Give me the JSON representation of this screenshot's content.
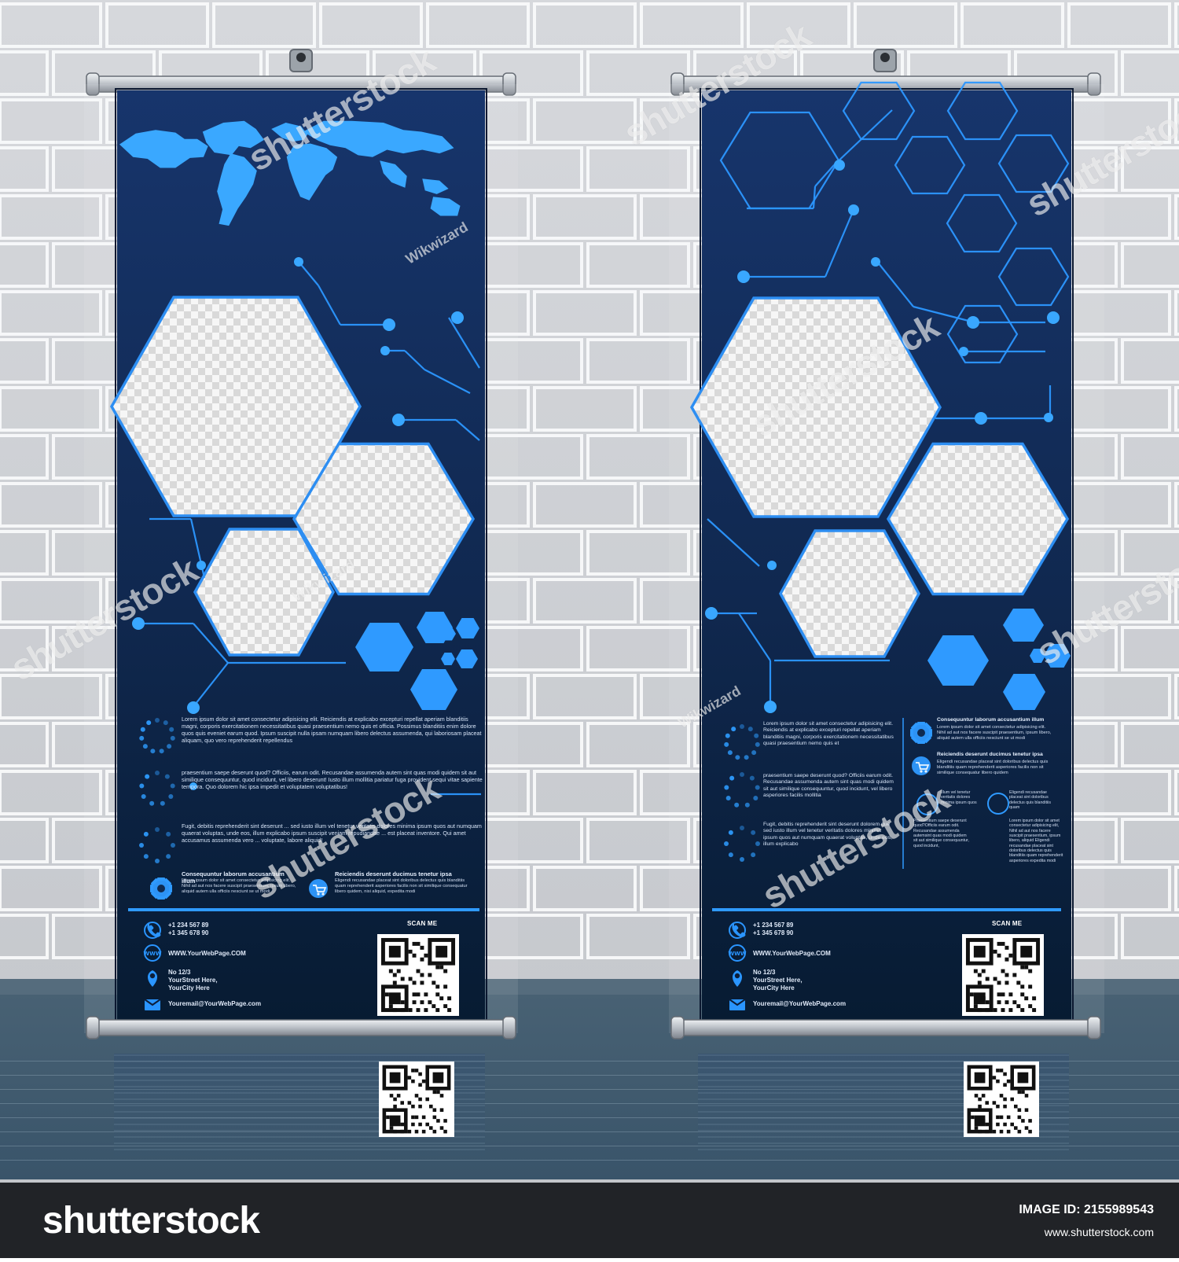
{
  "scene": {
    "colors": {
      "wall": "#cfd2d7",
      "brick_lines": "#ffffff",
      "floor": "#4b6d80",
      "banner_bg_top": "#17346c",
      "banner_bg_bottom": "#081b33",
      "banner_line": "#2f98ff",
      "banner_accent": "#39a7ff",
      "footer_bar": "#212327"
    },
    "watermarks": [
      "shutterstock",
      "shutterstock",
      "shutterstock",
      "shutterstock",
      "shutterstock",
      "shutterstock",
      "shutterstock",
      "shutterstock",
      "Wikwizard",
      "Wikwizard",
      "Wikwizard"
    ]
  },
  "banner_left": {
    "body_paragraph_1": "Lorem ipsum dolor sit amet consectetur adipisicing elit. Reiciendis at explicabo excepturi repellat aperiam blanditiis magni, corporis exercitationem necessitatibus quasi praesentium nemo quis et officia. Possimus blanditiis enim dolore quos quis eveniet earum quod. Ipsum suscipit nulla ipsam numquam libero delectus assumenda, qui laboriosam placeat aliquam, quo vero reprehenderit repellendus",
    "body_paragraph_2": "praesentium saepe deserunt quod? Officiis, earum odit. Recusandae assumenda autem sint quas modi quidem sit aut similique consequuntur, quod incidunt, vel libero deserunt! Iusto illum mollitia pariatur fuga provident sequi vitae sapiente tempora. Quo dolorem hic ipsa impedit et voluptatem voluptatibus!",
    "body_paragraph_3": "Fugit, debitis reprehenderit sint deserunt ... sed iusto illum vel tenetur veritatis dolores minima ipsum quos aut numquam quaerat voluptas, unde eos, illum explicabo ipsum suscipit veniam repudiandae ... est placeat inventore. Qui amet accusamus assumenda vero ... voluptate, labore aliquid!",
    "feature_1_title": "Consequuntur laborum accusantium illum",
    "feature_1_body": "Lorem ipsum dolor sit amet consectetur adipisicing elit. Nihil ad aut nos facere suscipit praesentium, ipsum libero, aliquid autem ulla officiis nesciunt se ut modi",
    "feature_2_title": "Reiciendis deserunt ducimus tenetur ipsa",
    "feature_2_body": "Eligendi recusandae placeat sint doloribus delectus quis blanditiis quam reprehenderit asperiores facilis non sit similique consequatur libero quidem, nisi aliquid, expedita modi",
    "phone": "+1 234 567 89\n+1 345 678 90",
    "website": "WWW.YourWebPage.COM",
    "address": "No 12/3\nYourStreet Here,\nYourCity Here",
    "email": "Youremail@YourWebPage.com",
    "scan_label": "SCAN ME"
  },
  "banner_right": {
    "body_paragraph_1": "Lorem ipsum dolor sit amet consectetur adipisicing elit. Reiciendis at explicabo excepturi repellat aperiam blanditiis magni, corporis exercitationem necessitatibus quasi praesentium nemo quis et",
    "body_paragraph_2": "praesentium saepe deserunt quod? Officiis earum odit. Recusandae assumenda autem sint quas modi quidem sit aut similique consequuntur, quod incidunt, vel libero asperiores facilis mollitia",
    "body_paragraph_3": "Fugit, debitis reprehenderit sint deserunt dolorem que sed iusto illum vel tenetur veritatis dolores minima ipsum quos aut numquam quaerat voluptas, unde eos, illum explicabo",
    "feature_1_title": "Consequuntur laborum accusantium illum",
    "feature_1_body": "Lorem ipsum dolor sit amet consectetur adipisicing elit. Nihil ad aut nos facere suscipit praesentium, ipsum libero, aliquid autem ulla officiis nesciunt se ut modi",
    "feature_2_title": "Reiciendis deserunt ducimus tenetur ipsa",
    "feature_2_body": "Eligendi recusandae placeat sint doloribus delectus quis blanditiis quam reprehenderit asperiores facilis non sit similique consequatur libero quidem",
    "mini_col_1_top": "Illum vel tenetur veritatis dolores minima ipsum quos",
    "mini_col_2_top": "Eligendi recusandae placeat sint doloribus delectus quis blanditiis quam",
    "mini_col_1_bottom": "Praesentium saepe deserunt quod?Officiis earum odit. Recusandae assumenda autemsint quas modi quidem sit aut similique consequuntur, quod incidunt,",
    "mini_col_2_bottom": "Lorem ipsum dolor sit amet consectetur adipisicing elit, Nihil ad aut nos facere suscipit praesentium, ipsum libero, aliquid Eligendi recusandae placeat sint doloribus delectus quis blanditiis quam reprehenderit asperiores expedita modi",
    "phone": "+1 234 567 89\n+1 345 678 90",
    "website": "WWW.YourWebPage.COM",
    "address": "No 12/3\nYourStreet Here,\nYourCity Here",
    "email": "Youremail@YourWebPage.com",
    "scan_label": "SCAN ME"
  },
  "footer": {
    "brand": "shutterstock",
    "image_id": "IMAGE ID: 2155989543",
    "url": "www.shutterstock.com"
  }
}
